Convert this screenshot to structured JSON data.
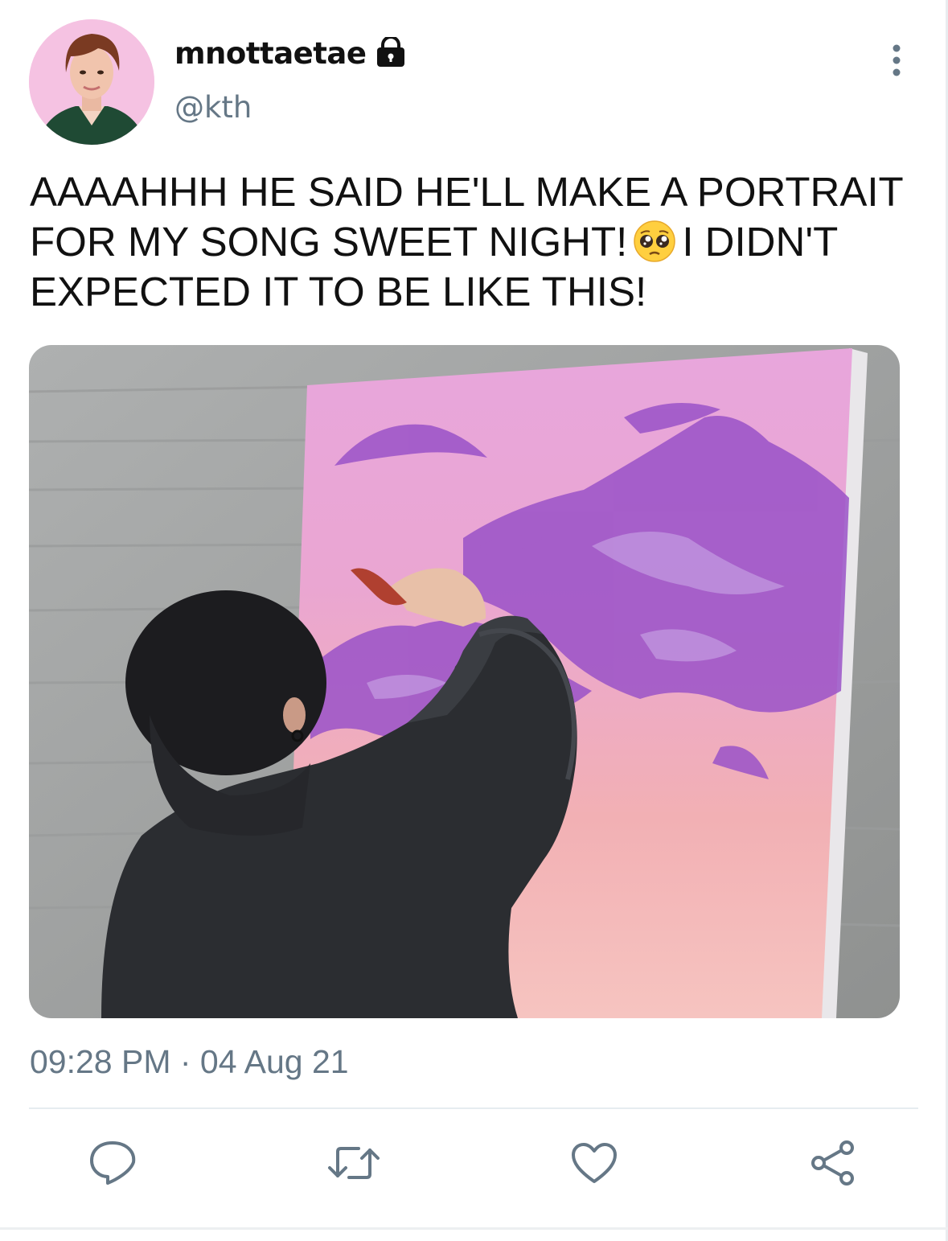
{
  "tweet": {
    "display_name": "mnottaetae",
    "handle": "@kth",
    "text_line1": "AAAAHHH HE SAID HE'LL MAKE A PORTRAIT",
    "text_line2a": "FOR MY SONG SWEET NIGHT!",
    "text_line2b": "I DIDN'T",
    "text_line3": "EXPECTED IT TO BE LIKE THIS!",
    "timestamp": "09:28 PM · 04 Aug 21"
  },
  "icons": {
    "verified_lock": "lock-icon",
    "more": "more-vertical-icon",
    "emoji": "pleading-face-emoji",
    "reply": "reply-icon",
    "retweet": "retweet-icon",
    "like": "heart-icon",
    "share": "share-icon"
  },
  "colors": {
    "text": "#111111",
    "secondary_text": "#657786",
    "divider": "#e6ecf0",
    "icon": "#657786"
  }
}
